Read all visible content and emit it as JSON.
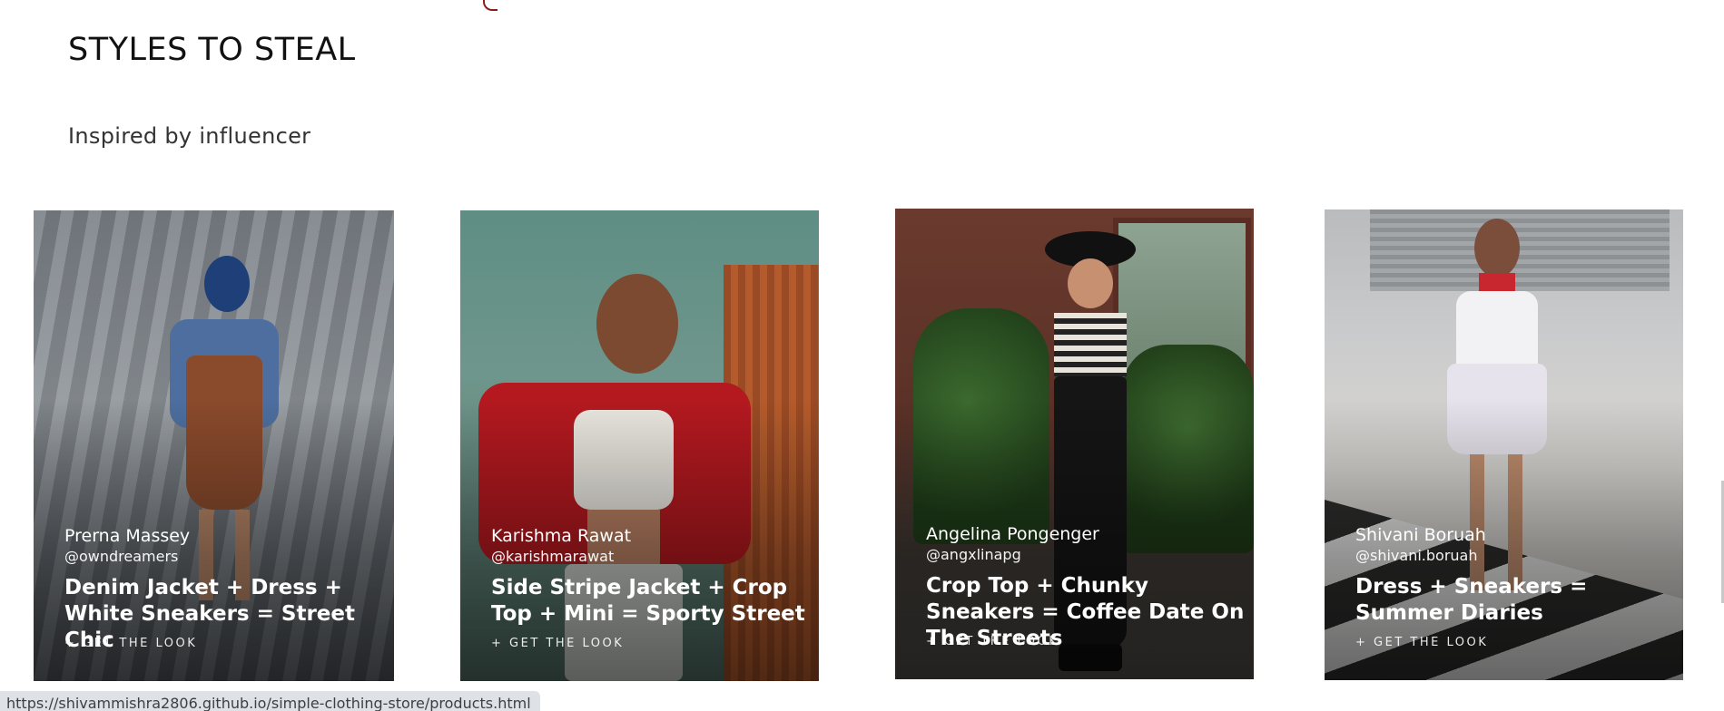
{
  "section": {
    "title": "STYLES TO STEAL",
    "subtitle": "Inspired by influencer"
  },
  "cards": [
    {
      "name": "Prerna Massey",
      "handle": "@owndreamers",
      "title": "Denim Jacket + Dress + White Sneakers = Street Chic",
      "cta": "+ GET THE LOOK"
    },
    {
      "name": "Karishma Rawat",
      "handle": "@karishmarawat",
      "title": "Side Stripe Jacket + Crop Top + Mini = Sporty Street",
      "cta": "+ GET THE LOOK"
    },
    {
      "name": "Angelina Pongenger",
      "handle": "@angxlinapg",
      "title": "Crop Top + Chunky Sneakers = Coffee Date On The Streets",
      "cta": "+ GET THE LOOK"
    },
    {
      "name": "Shivani Boruah",
      "handle": "@shivani.boruah",
      "title": "Dress + Sneakers = Summer Diaries",
      "cta": "+ GET THE LOOK"
    }
  ],
  "status_bar": {
    "url": "https://shivammishra2806.github.io/simple-clothing-store/products.html"
  }
}
